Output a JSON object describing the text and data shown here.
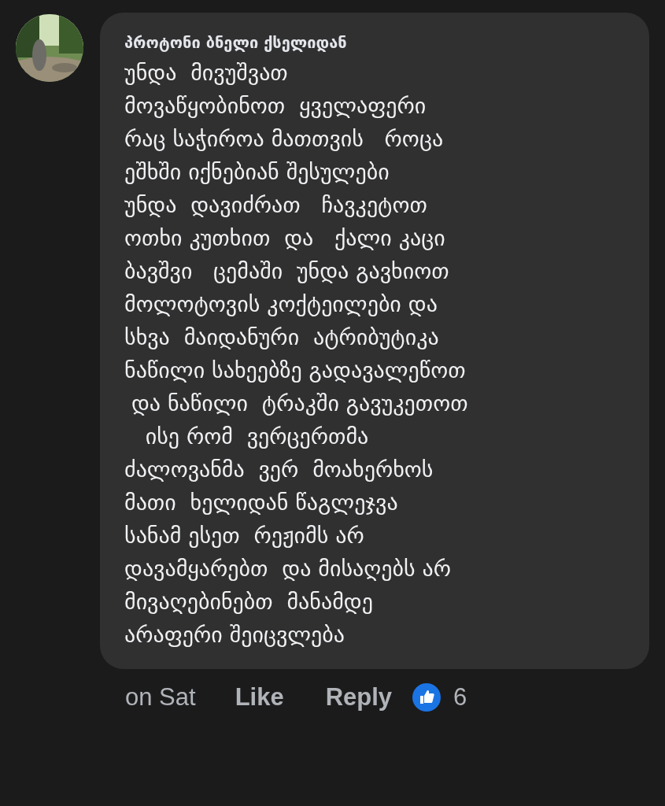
{
  "comment": {
    "author": "პროტონი ბნელი ქსელიდან",
    "text": "უნდა  მივუშვათ\nმოვაწყობინოთ  ყველაფერი\nრაც საჭიროა მათთვის   როცა\nეშხში იქნებიან შესულები\nუნდა  დავიძრათ   ჩავკეტოთ\nოთხი კუთხით  და   ქალი კაცი\nბავშვი   ცემაში  უნდა გავხიოთ\nმოლოტოვის კოქტეილები და\nსხვა  მაიდანური  ატრიბუტიკა\nნაწილი სახეებზე გადავალეწოთ\n და ნაწილი  ტრაკში გავუკეთოთ\n   ისე რომ  ვერცერთმა\nძალოვანმა  ვერ  მოახერხოს\nმათი  ხელიდან წაგლეჯვა\nსანამ ესეთ  რეჟიმს არ\nდავამყარებთ  და მისაღებს არ\nმივაღებინებთ  მანამდე\nარაფერი შეიცვლება",
    "time": "on Sat",
    "actions": [
      "Like",
      "Reply"
    ],
    "reaction_count": "6"
  }
}
